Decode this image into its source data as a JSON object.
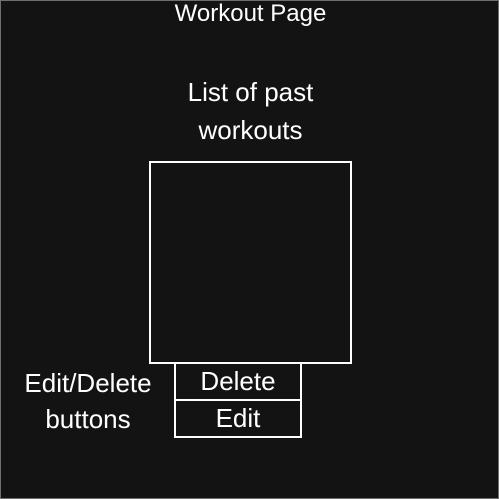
{
  "page": {
    "title": "Workout Page"
  },
  "workout_list": {
    "label_line1": "List of past",
    "label_line2": "workouts"
  },
  "annotation": {
    "label_line1": "Edit/Delete",
    "label_line2": "buttons"
  },
  "buttons": {
    "delete_label": "Delete",
    "edit_label": "Edit"
  },
  "colors": {
    "background": "#141313",
    "foreground": "#ffffff",
    "outer_border": "#6f6f6f"
  }
}
